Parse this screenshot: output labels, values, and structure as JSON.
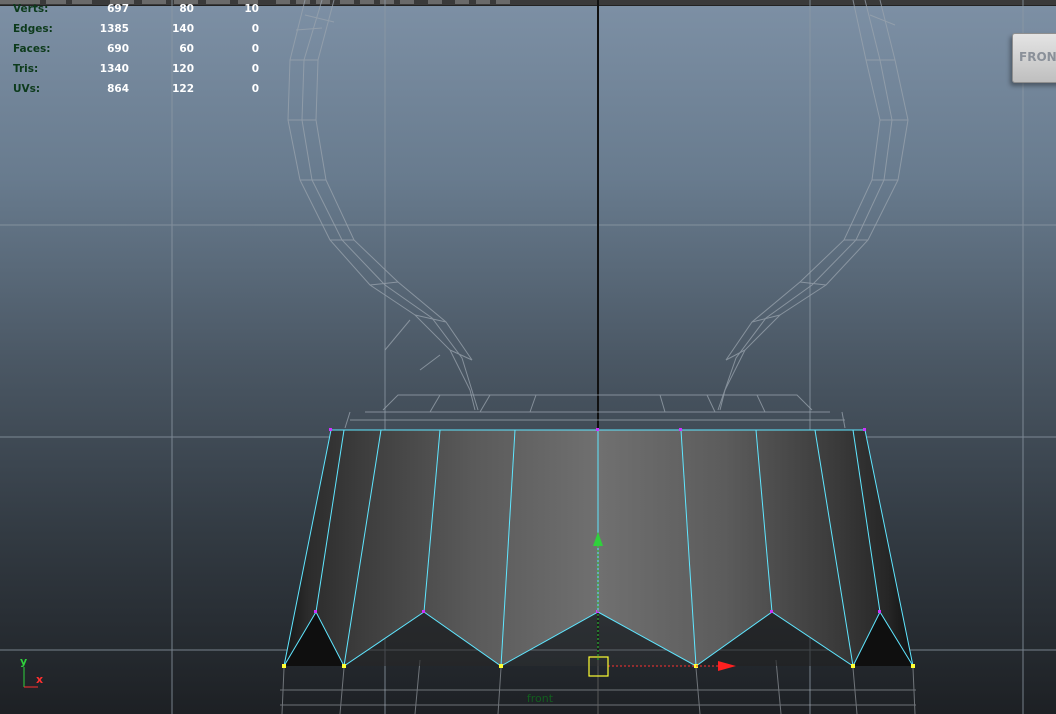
{
  "viewport": {
    "camera": "front",
    "view_cube_face": "FRONT"
  },
  "hud": {
    "rows": [
      {
        "label": "Verts:",
        "values": [
          "697",
          "80",
          "10"
        ]
      },
      {
        "label": "Edges:",
        "values": [
          "1385",
          "140",
          "0"
        ]
      },
      {
        "label": "Faces:",
        "values": [
          "690",
          "60",
          "0"
        ]
      },
      {
        "label": "Tris:",
        "values": [
          "1340",
          "120",
          "0"
        ]
      },
      {
        "label": "UVs:",
        "values": [
          "864",
          "122",
          "0"
        ]
      }
    ]
  },
  "axis": {
    "y_label": "y",
    "x_label": "x"
  },
  "colors": {
    "hud_label": "#0d3b1c",
    "hud_value": "#ffffff",
    "selected_edges": "#5fe6ff",
    "selected_vertex": "#ffff33",
    "unselected_vertex": "#cc33ff",
    "camera_label": "#125e1e",
    "axis_y": "#2fd13c",
    "axis_x": "#ff3030"
  }
}
